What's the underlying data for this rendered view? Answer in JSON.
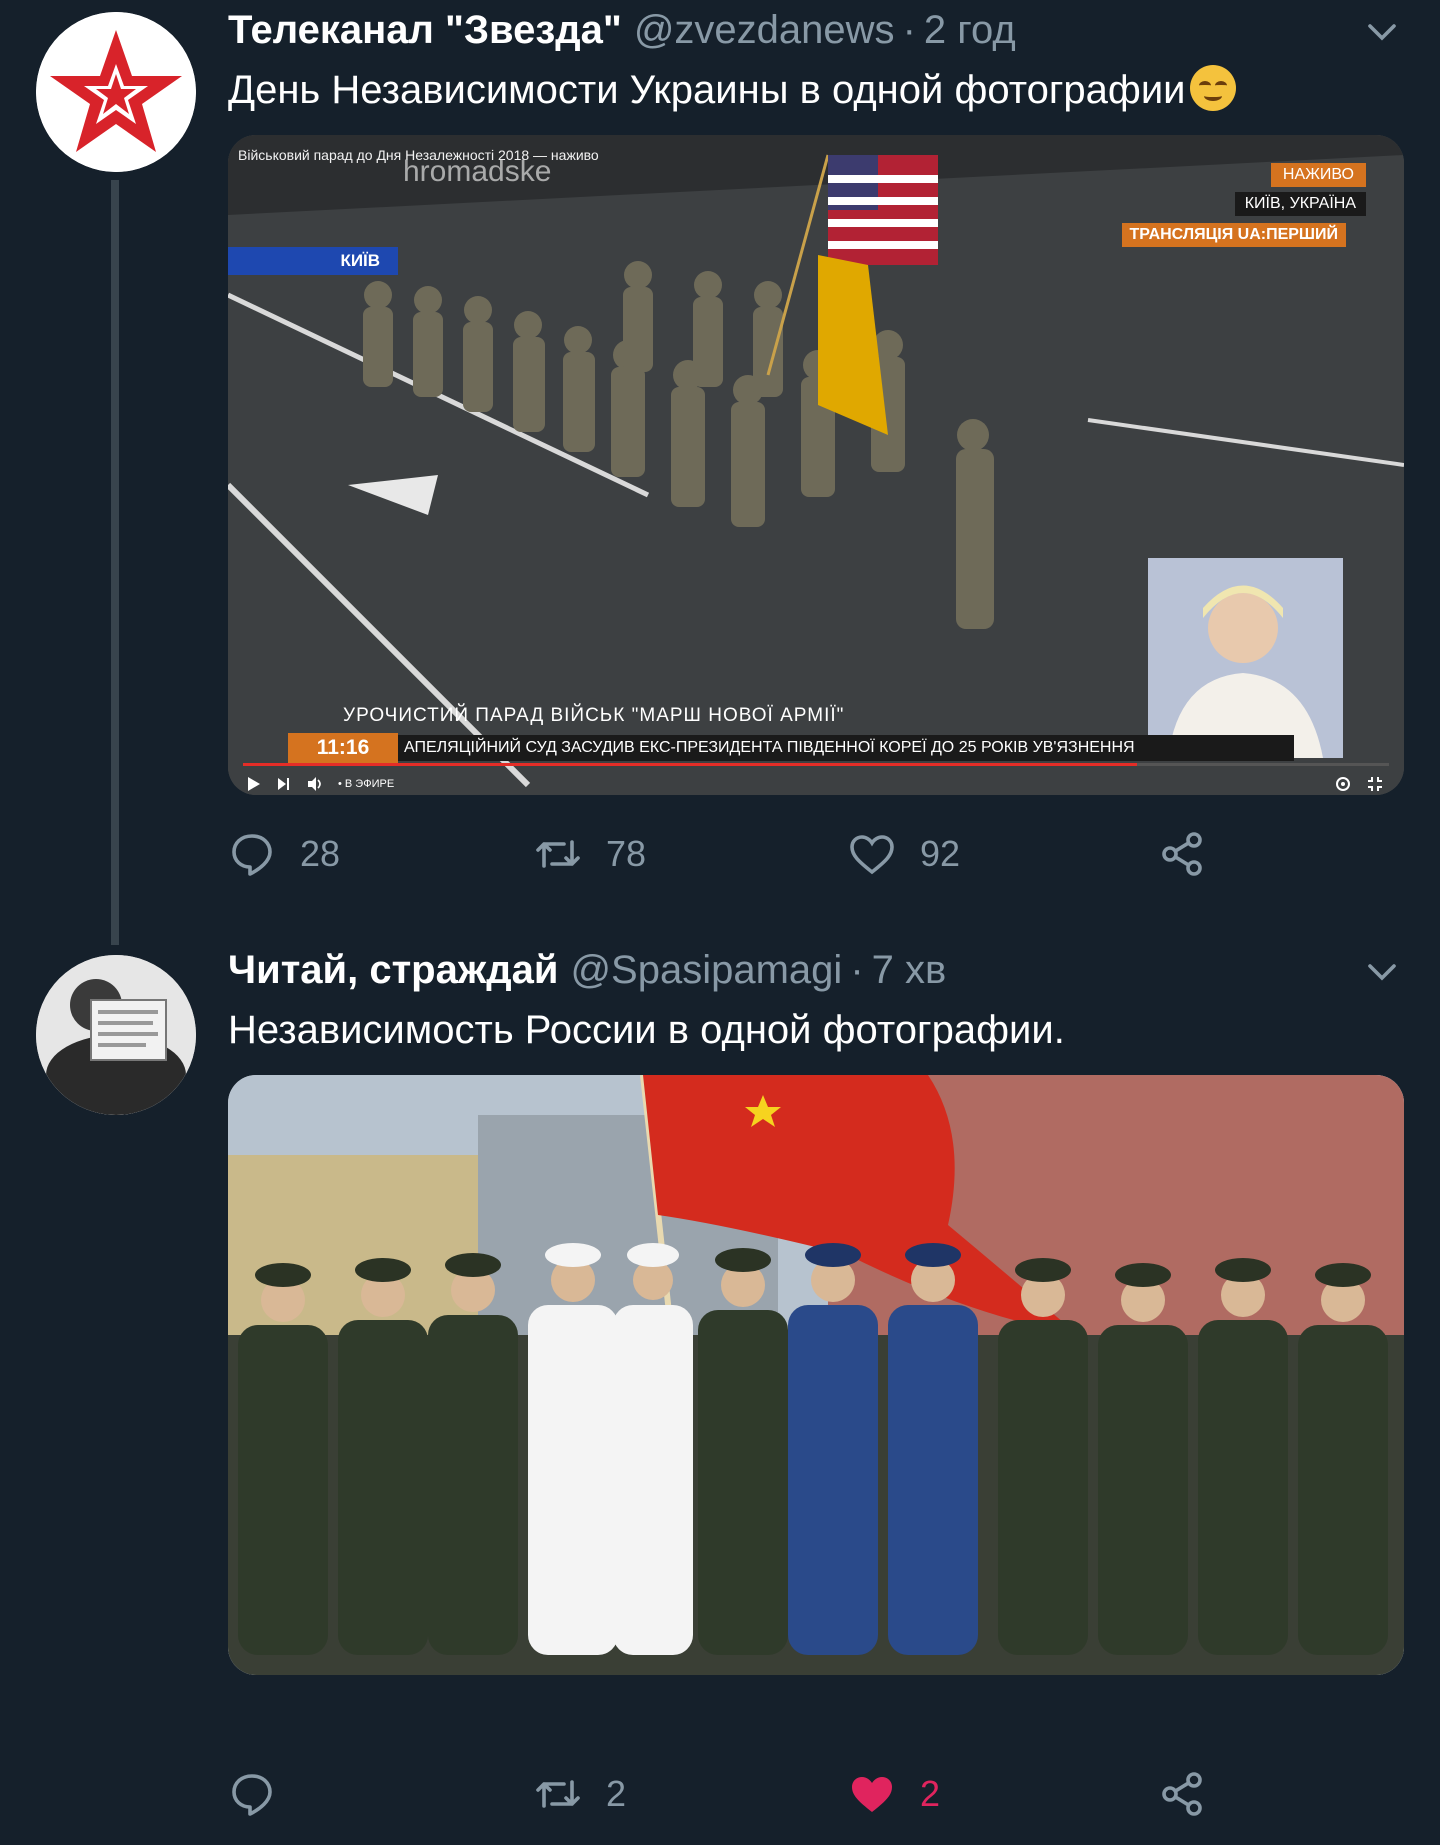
{
  "tweets": [
    {
      "author_name": "Телеканал \"Звезда\"",
      "handle": "@zvezdanews",
      "separator": "·",
      "time": "2 год",
      "text": "День Независимости Украины в одной фотографии",
      "media": {
        "video_title": "Військовий парад до Дня Незалежності 2018 — наживо",
        "watermark": "hromadske",
        "live_badge": "НАЖИВО",
        "location_badge": "КИЇВ, УКРАЇНА",
        "broadcast_badge": "ТРАНСЛЯЦІЯ UA:ПЕРШИЙ",
        "city_badge": "КИЇВ",
        "caption": "УРОЧИСТИЙ ПАРАД ВІЙСЬК \"МАРШ НОВОЇ АРМІЇ\"",
        "clock": "11:16",
        "ticker": "АПЕЛЯЦІЙНИЙ СУД ЗАСУДИВ ЕКС-ПРЕЗИДЕНТА ПІВДЕННОЇ КОРЕЇ ДО 25 РОКІВ УВ'ЯЗНЕННЯ",
        "player_status": "• В ЭФИРЕ",
        "progress": 0.78
      },
      "replies": "28",
      "retweets": "78",
      "likes": "92",
      "liked": false
    },
    {
      "author_name": "Читай, страждай",
      "handle": "@Spasipamagi",
      "separator": "·",
      "time": "7 хв",
      "text": "Независимость России в одной фотографии.",
      "replies": "",
      "retweets": "2",
      "likes": "2",
      "liked": true
    }
  ],
  "colors": {
    "background": "#15202b",
    "secondary_text": "#8899a6",
    "like_active": "#e0245e",
    "thread_line": "#38444d"
  }
}
